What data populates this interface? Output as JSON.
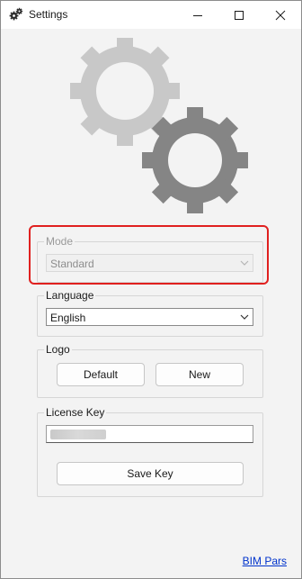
{
  "window": {
    "title": "Settings"
  },
  "mode": {
    "label": "Mode",
    "value": "Standard",
    "enabled": false
  },
  "language": {
    "label": "Language",
    "value": "English"
  },
  "logo": {
    "label": "Logo",
    "default_label": "Default",
    "new_label": "New"
  },
  "license": {
    "label": "License Key",
    "save_label": "Save Key"
  },
  "footer": {
    "link_label": "BIM Pars"
  },
  "colors": {
    "highlight": "#e0201f",
    "gear_light": "#c8c8c8",
    "gear_dark": "#858585",
    "link": "#0033cc"
  },
  "icons": {
    "app": "gears-icon",
    "minimize": "minimize-icon",
    "maximize": "maximize-icon",
    "close": "close-icon",
    "dropdown": "chevron-down-icon"
  }
}
